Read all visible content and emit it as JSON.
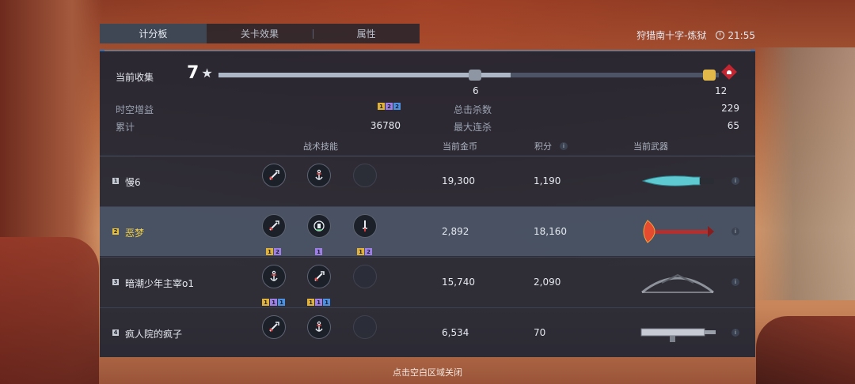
{
  "tabs": [
    {
      "label": "计分板",
      "active": true
    },
    {
      "label": "关卡效果",
      "active": false
    },
    {
      "label": "属性",
      "active": false
    }
  ],
  "header": {
    "map_name": "狩猎南十字-炼狱",
    "time": "21:55"
  },
  "collection": {
    "label": "当前收集",
    "count": "7",
    "progress_current": 7,
    "progress_max": 12,
    "milestones": [
      "6",
      "12"
    ]
  },
  "stats": {
    "time_gain_label": "时空增益",
    "time_gain_badges": [
      "1",
      "2",
      "2"
    ],
    "total_kills_label": "总击杀数",
    "total_kills": "229",
    "cumulative_label": "累计",
    "cumulative": "36780",
    "max_streak_label": "最大连杀",
    "max_streak": "65"
  },
  "columns": {
    "skills": "战术技能",
    "gold": "当前金币",
    "score": "积分",
    "weapon": "当前武器"
  },
  "players": [
    {
      "rank": "1",
      "name": "慢6",
      "gold": "19,300",
      "score": "1,190",
      "weapon_icon": "knife",
      "skills": [
        {
          "icon": "sword-icon",
          "badges": []
        },
        {
          "icon": "anchor-icon",
          "badges": []
        },
        {
          "icon": "empty",
          "badges": []
        }
      ]
    },
    {
      "rank": "2",
      "name": "恶梦",
      "gold": "2,892",
      "score": "18,160",
      "weapon_icon": "axe",
      "selected": true,
      "skills": [
        {
          "icon": "sword-icon",
          "badges": [
            "1",
            "2"
          ]
        },
        {
          "icon": "totem-icon",
          "badges": [
            "1"
          ]
        },
        {
          "icon": "dagger-icon",
          "badges": [
            "1",
            "2"
          ]
        }
      ]
    },
    {
      "rank": "3",
      "name": "暗潮少年主宰o1",
      "gold": "15,740",
      "score": "2,090",
      "weapon_icon": "bow",
      "skills": [
        {
          "icon": "anchor-icon",
          "badges": [
            "1",
            "1",
            "1"
          ]
        },
        {
          "icon": "sword-icon",
          "badges": [
            "1",
            "1",
            "1"
          ]
        },
        {
          "icon": "empty",
          "badges": []
        }
      ]
    },
    {
      "rank": "4",
      "name": "疯人院的疯子",
      "gold": "6,534",
      "score": "70",
      "weapon_icon": "rifle",
      "skills": [
        {
          "icon": "sword-icon",
          "badges": []
        },
        {
          "icon": "anchor-icon",
          "badges": []
        },
        {
          "icon": "empty",
          "badges": []
        }
      ]
    }
  ],
  "footer": "点击空白区域关闭",
  "colors": {
    "accent_gold": "#f0cf48",
    "badge_yellow": "#e0b23a",
    "badge_purple": "#9d7fe6",
    "badge_blue": "#4d8fe0"
  }
}
